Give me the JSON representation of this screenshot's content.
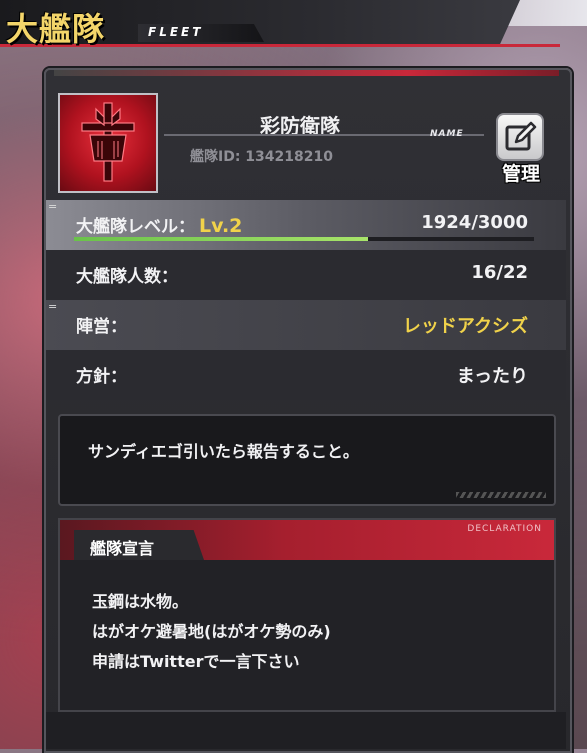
{
  "header": {
    "title": "大艦隊",
    "subtitle": "FLEET"
  },
  "fleet": {
    "name": "彩防衛隊",
    "id_text": "艦隊ID: 134218210",
    "name_tag": "NAME",
    "manage_label": "管理",
    "icons": {
      "emblem": "fleet-emblem-icon",
      "manage": "edit-icon"
    }
  },
  "stats": {
    "level_label": "大艦隊レベル：",
    "level_value": "Lv.2",
    "exp": "1924/3000",
    "exp_progress": 0.64,
    "members_label": "大艦隊人数：",
    "members_value": "16/22",
    "faction_label": "陣営：",
    "faction_value": "レッドアクシズ",
    "policy_label": "方針：",
    "policy_value": "まったり"
  },
  "message": "サンディエゴ引いたら報告すること。",
  "declaration": {
    "title": "艦隊宣言",
    "title_en": "DECLARATION",
    "lines": [
      "玉鋼は水物。",
      "はがオケ避暑地(はがオケ勢のみ)",
      "申請はTwitterで一言下さい"
    ]
  },
  "colors": {
    "accent": "#c9283a",
    "gold": "#f0d24a",
    "panel": "#2b2b30",
    "exp_bar": "#8ed85a"
  }
}
